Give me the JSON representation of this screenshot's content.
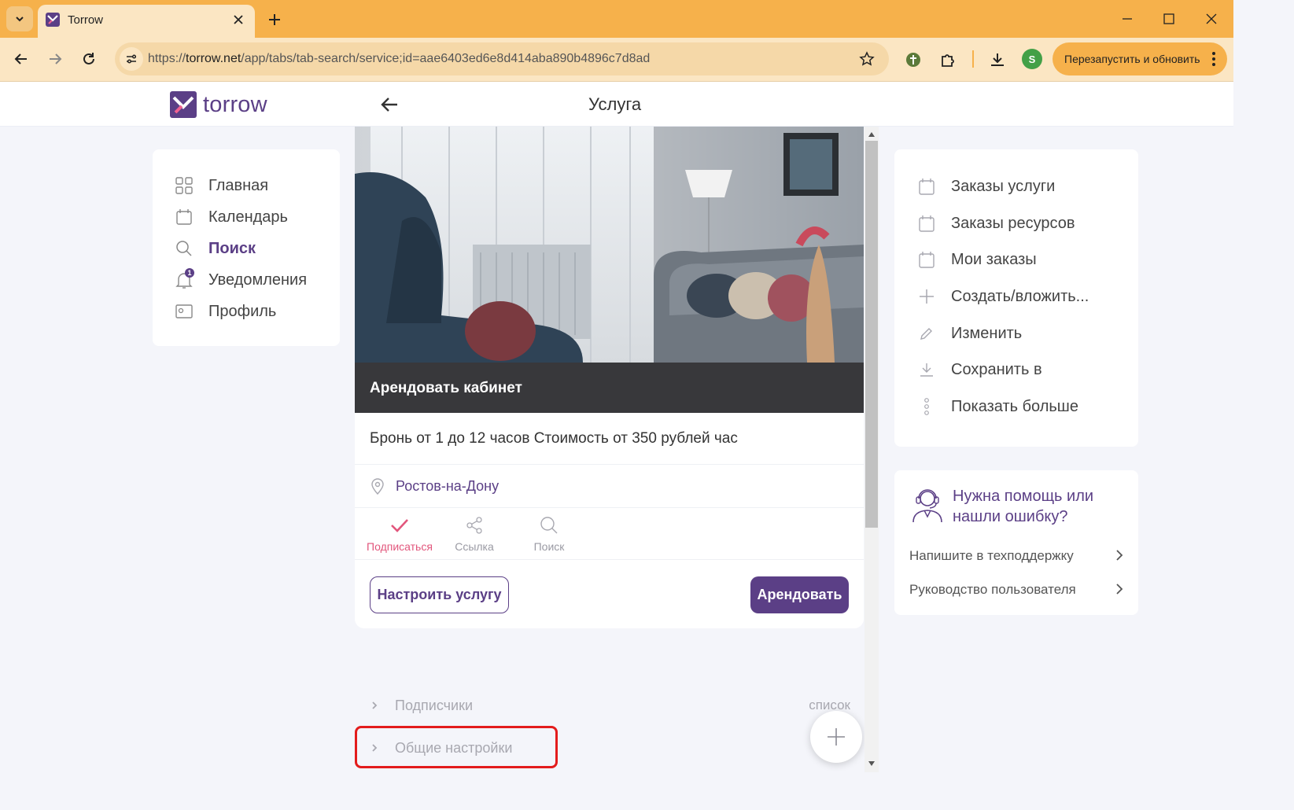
{
  "browser": {
    "tab_title": "Torrow",
    "url_prefix": "https://",
    "url_domain": "torrow.net",
    "url_path": "/app/tabs/tab-search/service;id=aae6403ed6e8d414aba890b4896c7d8ad",
    "profile_initial": "S",
    "relaunch_label": "Перезапустить и обновить",
    "colors": {
      "tabbar": "#f6b14b",
      "toolbar": "#fbe6c3"
    }
  },
  "app": {
    "logo_text": "torrow",
    "page_title": "Услуга",
    "brand_color": "#5b3f86",
    "accent_color": "#e2567c"
  },
  "leftnav": {
    "items": [
      {
        "label": "Главная",
        "icon": "grid-icon"
      },
      {
        "label": "Календарь",
        "icon": "calendar-icon"
      },
      {
        "label": "Поиск",
        "icon": "search-icon",
        "active": true
      },
      {
        "label": "Уведомления",
        "icon": "bell-icon",
        "badge": "1"
      },
      {
        "label": "Профиль",
        "icon": "profile-card-icon"
      }
    ]
  },
  "service": {
    "photo_caption": "Арендовать кабинет",
    "description": "Бронь от 1 до 12 часов Стоимость от 350 рублей час",
    "location": "Ростов-на-Дону",
    "actions": [
      {
        "label": "Подписаться",
        "icon": "check-icon",
        "active": true
      },
      {
        "label": "Ссылка",
        "icon": "share-icon"
      },
      {
        "label": "Поиск",
        "icon": "search-icon"
      }
    ],
    "configure_button": "Настроить услугу",
    "rent_button": "Арендовать",
    "sections": [
      {
        "label": "Подписчики",
        "right": "список"
      },
      {
        "label": "Общие настройки",
        "right": ""
      }
    ]
  },
  "rightmenu": {
    "items": [
      {
        "label": "Заказы услуги",
        "icon": "calendar-icon"
      },
      {
        "label": "Заказы ресурсов",
        "icon": "calendar-icon"
      },
      {
        "label": "Мои заказы",
        "icon": "calendar-icon"
      },
      {
        "label": "Создать/вложить...",
        "icon": "plus-icon"
      },
      {
        "label": "Изменить",
        "icon": "pencil-icon"
      },
      {
        "label": "Сохранить в",
        "icon": "download-icon"
      },
      {
        "label": "Показать больше",
        "icon": "more-vertical-icon"
      }
    ]
  },
  "help": {
    "title": "Нужна помощь или нашли ошибку?",
    "links": [
      {
        "label": "Напишите в техподдержку"
      },
      {
        "label": "Руководство пользователя"
      }
    ]
  }
}
